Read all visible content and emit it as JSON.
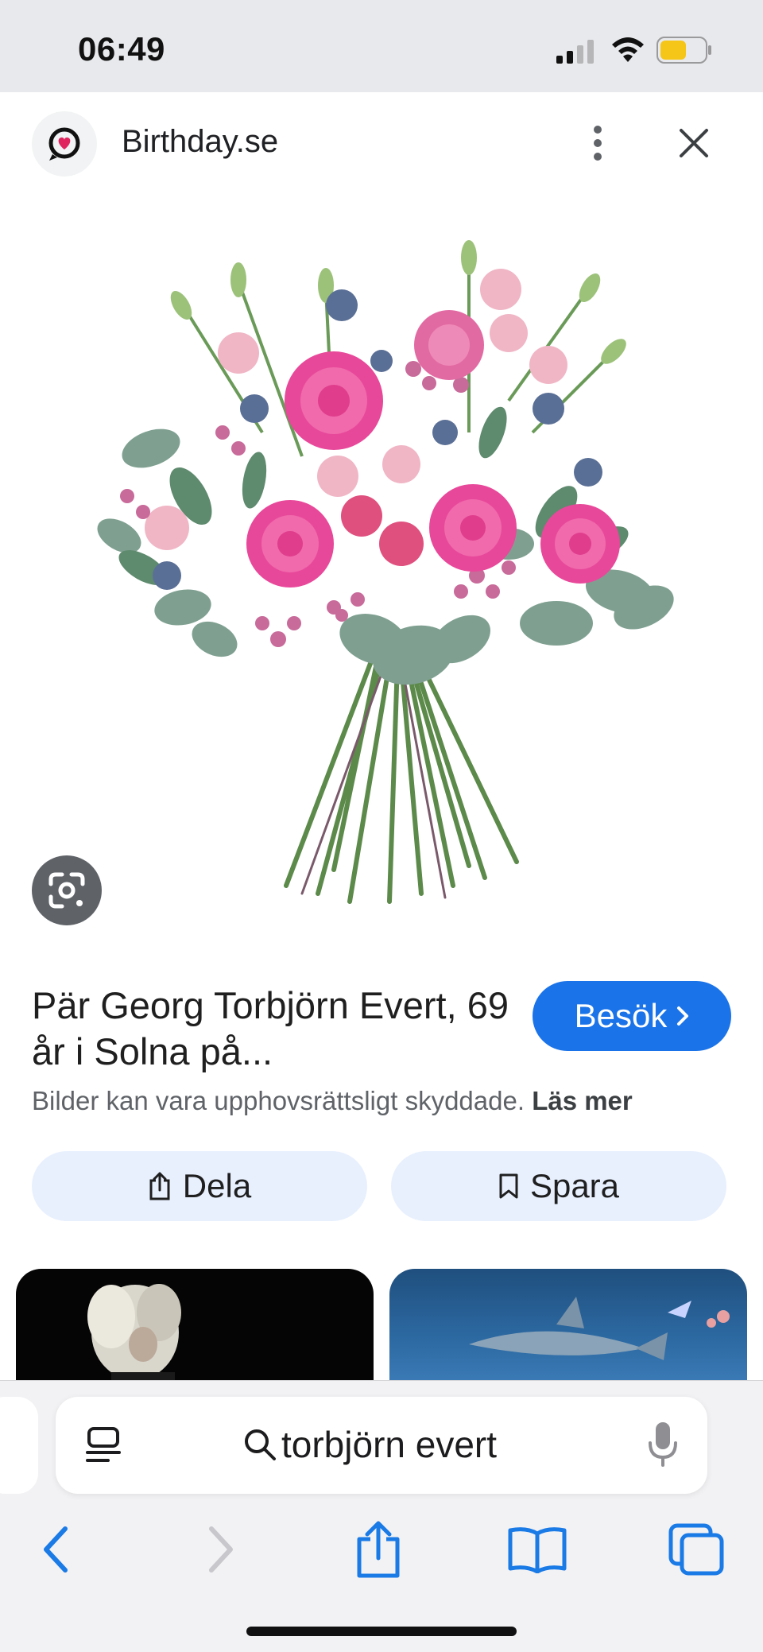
{
  "status_bar": {
    "time": "06:49"
  },
  "header": {
    "site_name": "Birthday.se",
    "logo_icon": "birthday-heart-logo",
    "more_icon": "more-vert-icon",
    "close_icon": "close-icon"
  },
  "image": {
    "alt": "Bouquet of pink ranunculus, lisianthus, waxflower and blue thistles",
    "lens_icon": "google-lens-icon"
  },
  "result": {
    "title": "Pär Georg Torbjörn Evert, 69 år i Solna på...",
    "visit_label": "Besök",
    "copyright_text": "Bilder kan vara upphovsrättsligt skyddade.",
    "read_more": "Läs mer"
  },
  "actions": {
    "share_label": "Dela",
    "save_label": "Spara"
  },
  "safari": {
    "search_query": "torbjörn evert"
  },
  "colors": {
    "accent": "#1a73e8",
    "action_bg": "#e8f0fe",
    "status_bg": "#e8e9ec",
    "battery": "#f5c518",
    "safari_blue": "#1a7ae6"
  }
}
